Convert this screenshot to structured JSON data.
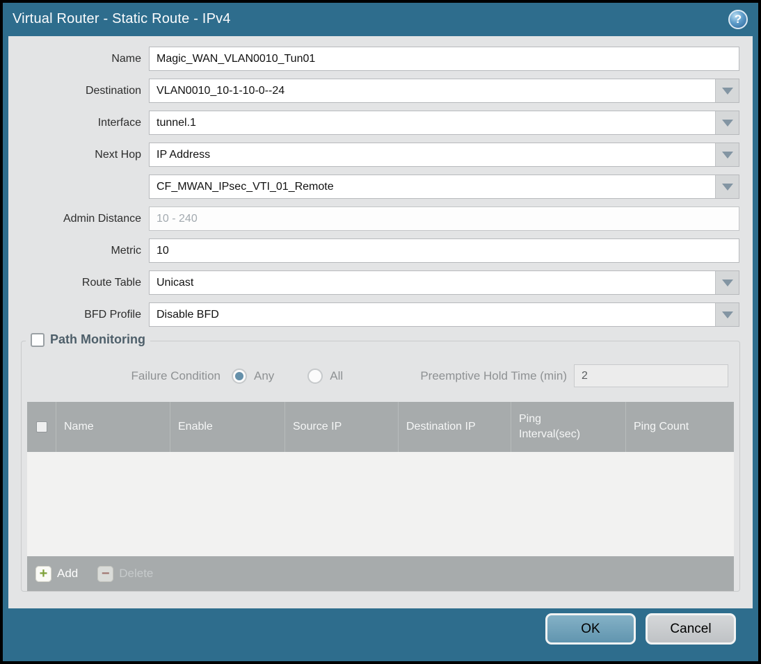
{
  "window": {
    "title": "Virtual Router - Static Route - IPv4",
    "help_glyph": "?"
  },
  "form": {
    "name": {
      "label": "Name",
      "value": "Magic_WAN_VLAN0010_Tun01"
    },
    "destination": {
      "label": "Destination",
      "value": "VLAN0010_10-1-10-0--24"
    },
    "interface": {
      "label": "Interface",
      "value": "tunnel.1"
    },
    "next_hop": {
      "label": "Next Hop",
      "type_value": "IP Address",
      "address_value": "CF_MWAN_IPsec_VTI_01_Remote"
    },
    "admin_distance": {
      "label": "Admin Distance",
      "placeholder": "10 - 240",
      "value": ""
    },
    "metric": {
      "label": "Metric",
      "value": "10"
    },
    "route_table": {
      "label": "Route Table",
      "value": "Unicast"
    },
    "bfd_profile": {
      "label": "BFD Profile",
      "value": "Disable BFD"
    }
  },
  "path_monitoring": {
    "title": "Path Monitoring",
    "enabled": false,
    "failure_condition": {
      "label": "Failure Condition",
      "option_any": "Any",
      "option_all": "All",
      "selected": "Any"
    },
    "preemptive_hold_time": {
      "label": "Preemptive Hold Time (min)",
      "value": "2"
    },
    "table": {
      "columns": [
        "Name",
        "Enable",
        "Source IP",
        "Destination IP",
        "Ping Interval(sec)",
        "Ping Count"
      ],
      "rows": []
    },
    "toolbar": {
      "add_label": "Add",
      "delete_label": "Delete",
      "delete_enabled": false
    }
  },
  "footer": {
    "ok_label": "OK",
    "cancel_label": "Cancel"
  },
  "colors": {
    "titlebar_teal": "#2e6d8d",
    "content_bg": "#e3e4e5",
    "table_header_bg": "#a7abac",
    "ok_button": "#6f9fb8",
    "cancel_button": "#c8cbce",
    "add_icon_green": "#7da037",
    "delete_icon_red": "#9c564c",
    "radio_selected_dot": "#6590aa"
  }
}
